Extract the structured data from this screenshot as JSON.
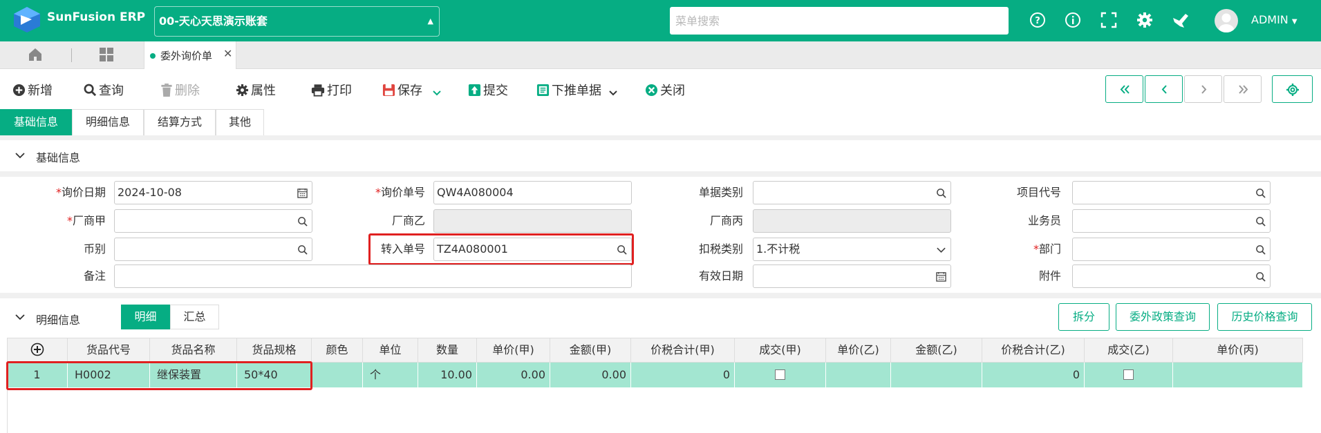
{
  "header": {
    "brand": "SunFusion ERP",
    "account_selector": "00-天心天思演示账套",
    "search_placeholder": "菜单搜索",
    "user": "ADMIN"
  },
  "tabs": {
    "open_tab": "委外询价单"
  },
  "toolbar": {
    "new": "新增",
    "query": "查询",
    "delete": "删除",
    "properties": "属性",
    "print": "打印",
    "save": "保存",
    "submit": "提交",
    "push_down": "下推单据",
    "close": "关闭"
  },
  "section_tabs": [
    "基础信息",
    "明细信息",
    "结算方式",
    "其他"
  ],
  "basic_section_title": "基础信息",
  "form": {
    "inquiry_date": {
      "label": "询价日期",
      "value": "2024-10-08"
    },
    "inquiry_no": {
      "label": "询价单号",
      "value": "QW4A080004"
    },
    "doc_type": {
      "label": "单据类别",
      "value": ""
    },
    "project_code": {
      "label": "项目代号",
      "value": ""
    },
    "vendor_a": {
      "label": "厂商甲",
      "value": ""
    },
    "vendor_b": {
      "label": "厂商乙",
      "value": ""
    },
    "vendor_c": {
      "label": "厂商丙",
      "value": ""
    },
    "salesman": {
      "label": "业务员",
      "value": ""
    },
    "currency": {
      "label": "币别",
      "value": ""
    },
    "transfer_no": {
      "label": "转入单号",
      "value": "TZ4A080001"
    },
    "tax_type": {
      "label": "扣税类别",
      "value": "1.不计税"
    },
    "department": {
      "label": "部门",
      "value": ""
    },
    "remark": {
      "label": "备注",
      "value": ""
    },
    "valid_date": {
      "label": "有效日期",
      "value": ""
    },
    "attachment": {
      "label": "附件",
      "value": ""
    }
  },
  "detail": {
    "title": "明细信息",
    "seg_detail": "明细",
    "seg_summary": "汇总",
    "btn_split": "拆分",
    "btn_policy": "委外政策查询",
    "btn_history": "历史价格查询",
    "columns": [
      "货品代号",
      "货品名称",
      "货品规格",
      "颜色",
      "单位",
      "数量",
      "单价(甲)",
      "金额(甲)",
      "价税合计(甲)",
      "成交(甲)",
      "单价(乙)",
      "金额(乙)",
      "价税合计(乙)",
      "成交(乙)",
      "单价(丙)"
    ],
    "rows": [
      {
        "no": "1",
        "code": "H0002",
        "name": "继保装置",
        "spec": "50*40",
        "color": "",
        "unit": "个",
        "qty": "10.00",
        "price_a": "0.00",
        "amount_a": "0.00",
        "total_a": "0",
        "deal_a": false,
        "price_b": "",
        "amount_b": "",
        "total_b": "0",
        "deal_b": false,
        "price_c": ""
      }
    ]
  },
  "colors": {
    "primary": "#06ad83",
    "highlight": "#e02020",
    "row_selected": "#a3e6d1"
  }
}
